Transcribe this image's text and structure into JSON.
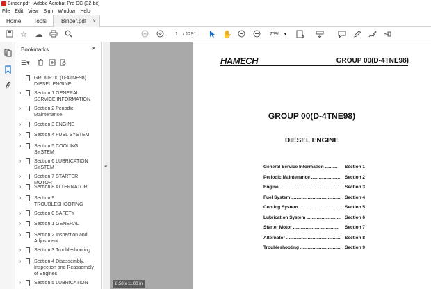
{
  "window": {
    "title": "Binder.pdf - Adobe Acrobat Pro DC (32-bit)"
  },
  "menu": [
    "File",
    "Edit",
    "View",
    "Sign",
    "Window",
    "Help"
  ],
  "tabs": {
    "home": "Home",
    "tools": "Tools",
    "document": "Binder.pdf",
    "close": "×"
  },
  "toolbar": {
    "current_page": "1",
    "total_pages": "/ 1291",
    "zoom": "75%"
  },
  "bookmarks": {
    "title": "Bookmarks",
    "close": "×",
    "items": [
      {
        "label": "GROUP 00 (D-4TNE98) DIESEL ENGINE",
        "chevron": ""
      },
      {
        "label": "Section 1 GENERAL SERVICE INFORMATION",
        "chevron": "›"
      },
      {
        "label": "Section 2 Periodic Maintenance",
        "chevron": "›"
      },
      {
        "label": "Section 3 ENGINE",
        "chevron": "›"
      },
      {
        "label": "Section 4 FUEL SYSTEM",
        "chevron": "›"
      },
      {
        "label": "Section 5 COOLING SYSTEM",
        "chevron": "›"
      },
      {
        "label": "Section 6 LUBRICATION SYSTEM",
        "chevron": "›"
      },
      {
        "label": "Section 7 STARTER MOTOR",
        "chevron": "›"
      },
      {
        "label": "Section 8 ALTERNATOR",
        "chevron": "›"
      },
      {
        "label": "Section 9 TROUBLESHOOTING",
        "chevron": "›"
      },
      {
        "label": "Section 0 SAFETY",
        "chevron": "›"
      },
      {
        "label": "Section 1 GENERAL",
        "chevron": "›"
      },
      {
        "label": "Section 2 Inspection and Adjustment",
        "chevron": "›"
      },
      {
        "label": "Section 3 Troubleshooting",
        "chevron": "›"
      },
      {
        "label": "Section 4 Disassembly, Inspection and Reassembly of Engines",
        "chevron": "›"
      },
      {
        "label": "Section 5 LUBRICATION",
        "chevron": "›"
      }
    ]
  },
  "page": {
    "logo": "HAMECH",
    "header_group": "GROUP 00(D-4TNE98)",
    "group_title": "GROUP 00(D-4TNE98)",
    "engine_title": "DIESEL ENGINE",
    "toc": [
      {
        "label": "General Service Information ..........",
        "section": "Section 1"
      },
      {
        "label": "Periodic Maintenance .......................",
        "section": "Section 2"
      },
      {
        "label": "Engine ....................................................",
        "section": "Section 3"
      },
      {
        "label": "Fuel System ........................................",
        "section": "Section 4"
      },
      {
        "label": "Cooling System ..................................",
        "section": "Section 5"
      },
      {
        "label": "Lubrication System ...........................",
        "section": "Section 6"
      },
      {
        "label": "Starter Motor .....................................",
        "section": "Section 7"
      },
      {
        "label": "Alternator ............................................",
        "section": "Section 8"
      },
      {
        "label": "Troubleshooting .................................",
        "section": "Section 9"
      }
    ],
    "size_badge": "8.50 x 11.00 in"
  }
}
